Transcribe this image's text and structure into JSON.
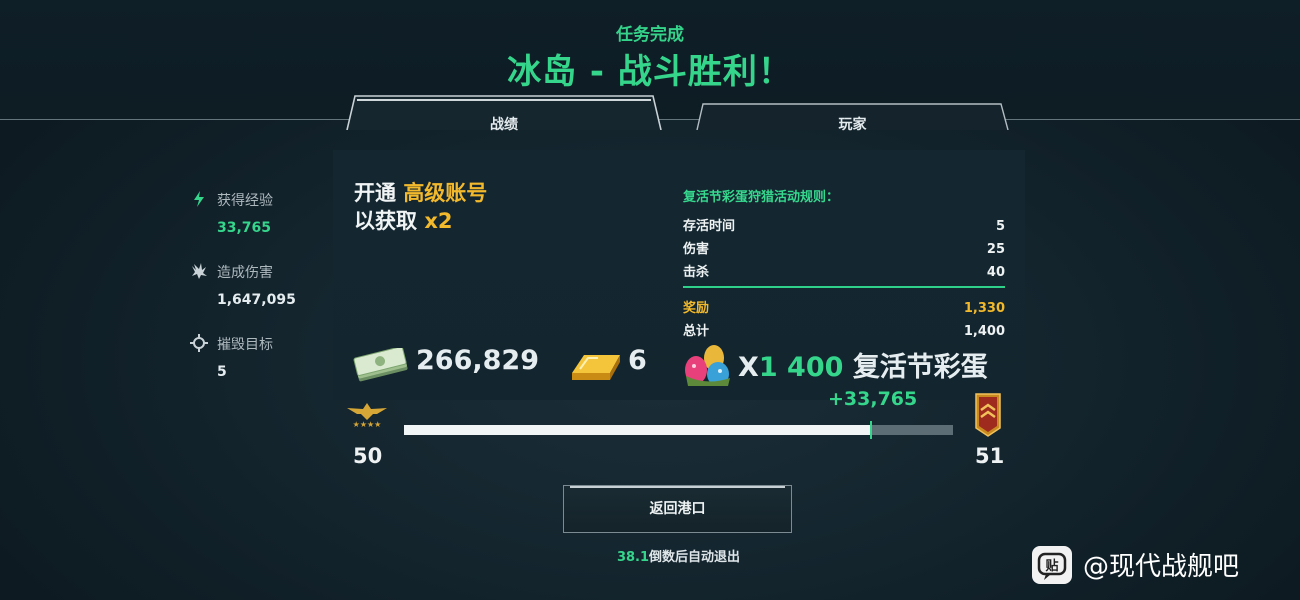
{
  "header": {
    "subtitle": "任务完成",
    "title": "冰岛 - 战斗胜利！"
  },
  "tabs": [
    {
      "label": "战绩",
      "active": true
    },
    {
      "label": "玩家",
      "active": false
    }
  ],
  "stats": [
    {
      "icon": "lightning-icon",
      "label": "获得经验",
      "value": "33,765",
      "value_color": "#35d68c"
    },
    {
      "icon": "explosion-icon",
      "label": "造成伤害",
      "value": "1,647,095",
      "value_color": "#eef2f3"
    },
    {
      "icon": "crosshair-icon",
      "label": "摧毁目标",
      "value": "5",
      "value_color": "#eef2f3"
    }
  ],
  "promo": {
    "line1_prefix": "开通",
    "line1_highlight": "高级账号",
    "line2_prefix": "以获取",
    "line2_highlight": "x2"
  },
  "rules": {
    "title": "复活节彩蛋狩猎活动规则：",
    "rows": [
      {
        "label": "存活时间",
        "value": "5"
      },
      {
        "label": "伤害",
        "value": "25"
      },
      {
        "label": "击杀",
        "value": "40"
      }
    ],
    "reward": {
      "label": "奖励",
      "value": "1,330"
    },
    "total": {
      "label": "总计",
      "value": "1,400"
    }
  },
  "rewards": {
    "money": {
      "icon": "cash-icon",
      "value": "266,829"
    },
    "gold": {
      "icon": "gold-bar-icon",
      "value": "6"
    },
    "eggs": {
      "icon": "easter-eggs-icon",
      "prefix": "X",
      "multiplier": "1",
      "count": "400",
      "label": "复活节彩蛋"
    }
  },
  "progress": {
    "xp_gain": "+33,765",
    "current_level": "50",
    "next_level": "51",
    "fill_percent": 85
  },
  "buttons": {
    "return_port": "返回港口"
  },
  "countdown": {
    "seconds": "38.1",
    "text": "倒数后自动退出"
  },
  "watermark": {
    "text": "@现代战舰吧",
    "icon_char": "贴"
  },
  "colors": {
    "accent_green": "#35d68c",
    "gold": "#f2b92c",
    "background": "#13242d"
  }
}
